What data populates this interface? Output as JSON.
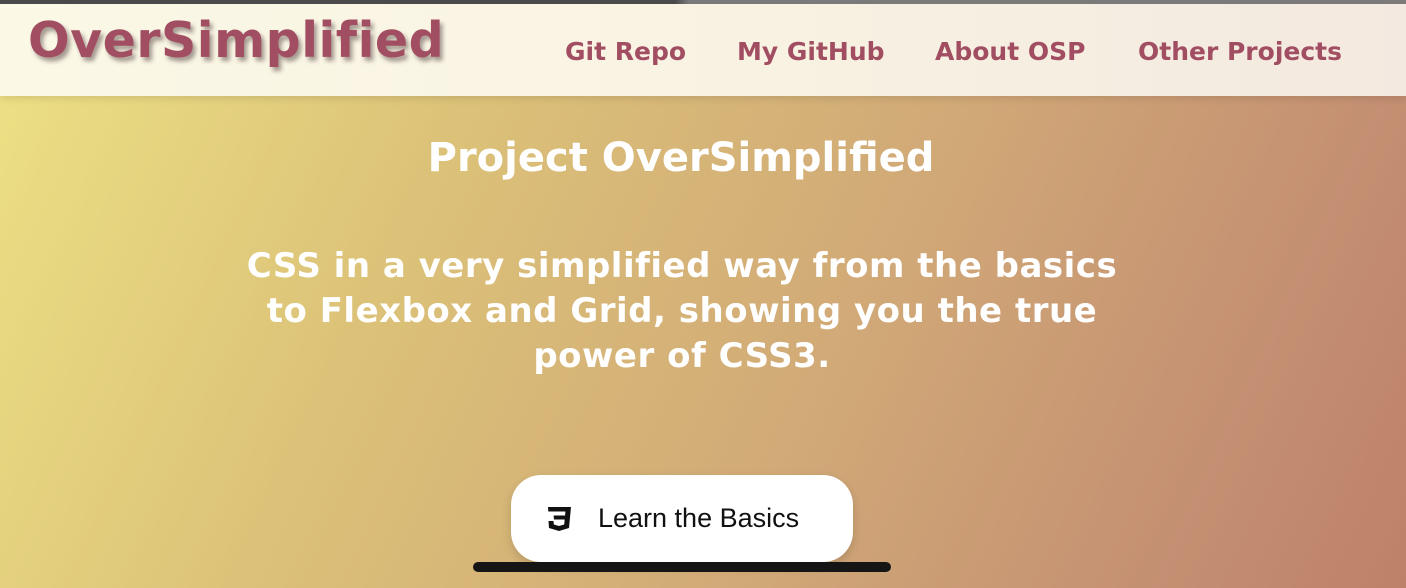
{
  "header": {
    "logo": "OverSimplified",
    "nav": [
      {
        "label": "Git Repo"
      },
      {
        "label": "My GitHub"
      },
      {
        "label": "About OSP"
      },
      {
        "label": "Other Projects"
      }
    ]
  },
  "hero": {
    "title": "Project OverSimplified",
    "subtitle": "CSS in a very simplified way from the basics to Flexbox and Grid, showing you the true power of CSS3.",
    "cta": {
      "label": "Learn the Basics",
      "icon": "css3-icon"
    }
  },
  "colors": {
    "brand": "#a24e62",
    "gradient_start": "#ede285",
    "gradient_end": "#bd816a",
    "cta_bg": "#ffffff"
  }
}
